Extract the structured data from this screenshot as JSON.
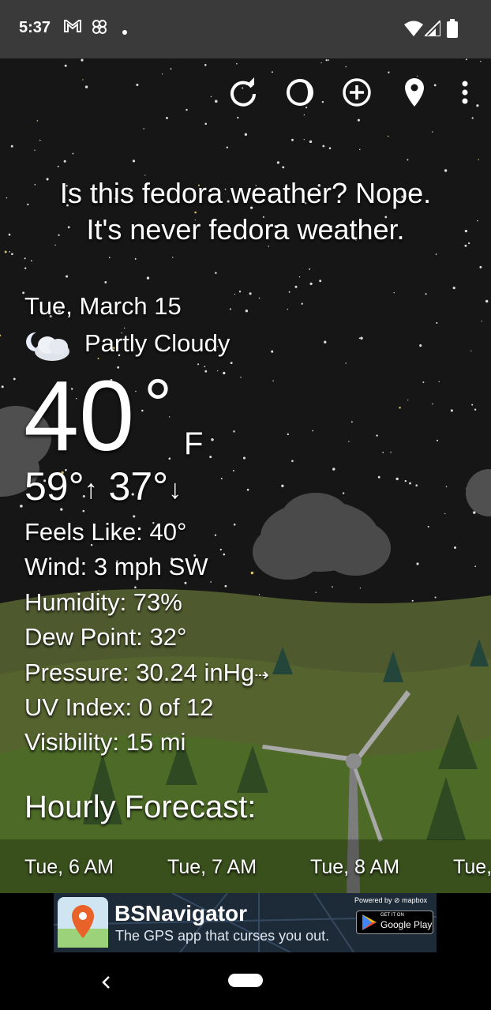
{
  "status_bar": {
    "time": "5:37",
    "left_icons": [
      "gmail-icon",
      "pinwheel-icon",
      "dot-icon"
    ],
    "right_icons": [
      "wifi-icon",
      "signal-icon",
      "battery-icon"
    ]
  },
  "toolbar": {
    "icons": [
      "refresh-icon",
      "moon-phase-icon",
      "add-location-icon",
      "location-pin-icon",
      "more-vert-icon"
    ]
  },
  "quote": {
    "line1": "Is this fedora weather? Nope.",
    "line2": "It's never fedora weather."
  },
  "current": {
    "date": "Tue, March 15",
    "condition": "Partly Cloudy",
    "condition_icon": "partly-cloudy-night-icon",
    "temperature": "40",
    "degree": "°",
    "unit": "F",
    "high": "59°",
    "high_arrow": "↑",
    "low": "37°",
    "low_arrow": "↓"
  },
  "details": {
    "feels_like": "Feels Like:  40°",
    "wind": "Wind:  3 mph SW",
    "humidity": "Humidity:  73%",
    "dew_point": "Dew Point:  32°",
    "pressure": "Pressure:  30.24 inHg",
    "pressure_trend": "⇢",
    "uv_index": "UV Index:  0 of 12",
    "visibility": "Visibility:  15 mi"
  },
  "hourly": {
    "title": "Hourly Forecast:",
    "hours": [
      "Tue, 6 AM",
      "Tue, 7 AM",
      "Tue, 8 AM",
      "Tue,"
    ]
  },
  "ad": {
    "title": "BSNavigator",
    "subtitle": "The GPS app that curses you out.",
    "powered_by": "Powered by ⊘ mapbox",
    "store_small": "GET IT ON",
    "store": "Google Play"
  },
  "nav": {
    "icons": [
      "back-icon",
      "home-pill-icon"
    ]
  },
  "colors": {
    "sky": "#161616",
    "status_bar": "#3a3a3a",
    "hill": "#5c6a34",
    "ad_bg": "#1d2b39"
  }
}
